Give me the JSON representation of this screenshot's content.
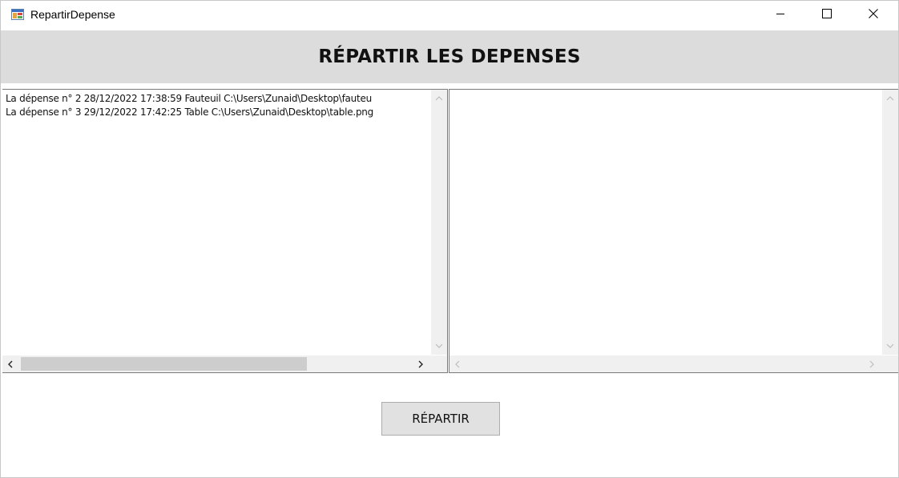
{
  "window": {
    "title": "RepartirDepense",
    "app_icon": "winforms-app-icon",
    "controls": [
      "minimize-icon",
      "maximize-icon",
      "close-icon"
    ]
  },
  "header": {
    "title": "RÉPARTIR LES DEPENSES",
    "background": "#dcdcdc"
  },
  "left_list": {
    "items": [
      "La dépense n° 2 28/12/2022 17:38:59 Fauteuil C:\\Users\\Zunaid\\Desktop\\fauteu",
      "La dépense n° 3 29/12/2022 17:42:25 Table C:\\Users\\Zunaid\\Desktop\\table.png"
    ]
  },
  "right_list": {
    "items": []
  },
  "action_button": {
    "label": "RÉPARTIR"
  }
}
